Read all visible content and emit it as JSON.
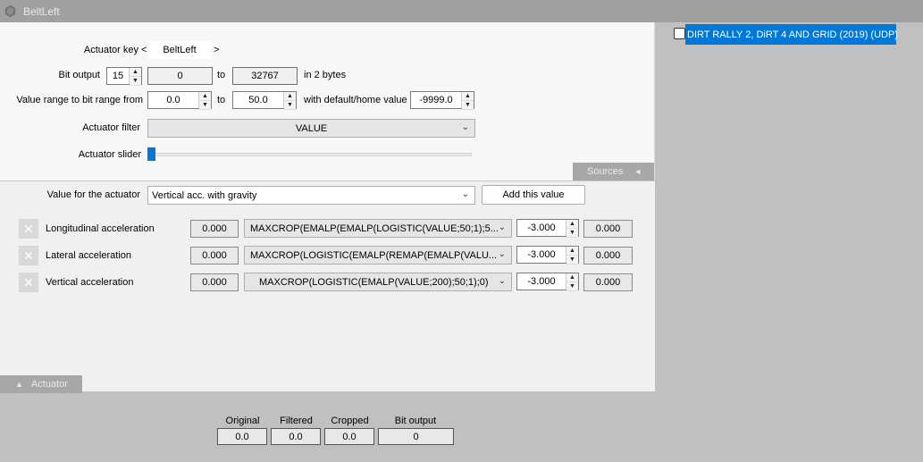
{
  "window": {
    "title": "BeltLeft"
  },
  "actuator_key": {
    "label": "Actuator key",
    "prev": "<",
    "value": "BeltLeft",
    "next": ">"
  },
  "bit_output": {
    "label": "Bit output",
    "bits": "15",
    "from": "0",
    "to_label": "to",
    "to": "32767",
    "suffix": "in 2 bytes"
  },
  "value_range": {
    "label": "Value range to bit range from",
    "from": "0.0",
    "to_label": "to",
    "to": "50.0",
    "default_label": "with default/home value",
    "default": "-9999.0"
  },
  "actuator_filter": {
    "label": "Actuator filter",
    "value": "VALUE"
  },
  "actuator_slider": {
    "label": "Actuator slider",
    "position": 0
  },
  "sources_tab": {
    "label": "Sources",
    "arrow": "◄"
  },
  "value_for_actuator": {
    "label": "Value for the actuator",
    "selected": "Vertical acc. with gravity",
    "add_button": "Add this value"
  },
  "values": [
    {
      "name": "Longitudinal acceleration",
      "input": "0.000",
      "formula": "MAXCROP(EMALP(EMALP(LOGISTIC(VALUE;50;1);5...",
      "factor": "-3.000",
      "output": "0.000"
    },
    {
      "name": "Lateral acceleration",
      "input": "0.000",
      "formula": "MAXCROP(LOGISTIC(EMALP(REMAP(EMALP(VALU...",
      "factor": "-3.000",
      "output": "0.000"
    },
    {
      "name": "Vertical acceleration",
      "input": "0.000",
      "formula": "MAXCROP(LOGISTIC(EMALP(VALUE;200);50;1);0)",
      "factor": "-3.000",
      "output": "0.000"
    }
  ],
  "actuator_tab": {
    "label": "Actuator",
    "arrow": "▲"
  },
  "readouts": [
    {
      "label": "Original",
      "value": "0.0"
    },
    {
      "label": "Filtered",
      "value": "0.0"
    },
    {
      "label": "Cropped",
      "value": "0.0"
    },
    {
      "label": "Bit output",
      "value": "0"
    }
  ],
  "sources": [
    {
      "label": "DIRT RALLY 2, DiRT 4 AND GRID (2019) (UDP)",
      "checked": false
    }
  ],
  "colors": {
    "selection": "#0078d7",
    "slider_thumb": "#0078d7",
    "panel_gray": "#c0c0c0"
  }
}
